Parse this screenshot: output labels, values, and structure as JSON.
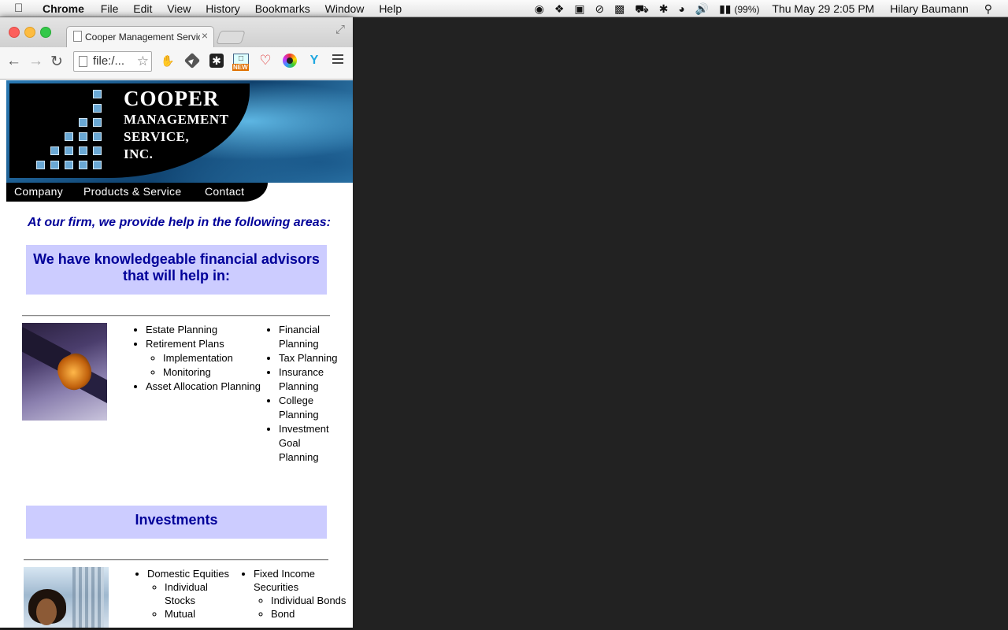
{
  "menubar": {
    "app": "Chrome",
    "menus": [
      "File",
      "Edit",
      "View",
      "History",
      "Bookmarks",
      "Window",
      "Help"
    ],
    "battery": "(99%)",
    "clock": "Thu May 29  2:05 PM",
    "user": "Hilary Baumann"
  },
  "browser": {
    "tab_title": "Cooper Management Services",
    "url": "file:/..."
  },
  "site": {
    "logo": {
      "line1": "COOPER",
      "line2": "MANAGEMENT",
      "line3": "SERVICE,",
      "line4": "INC."
    },
    "nav": {
      "company": "Company",
      "products": "Products & Service",
      "contact": "Contact"
    },
    "intro": "At our firm, we provide help in the following areas:",
    "advisors_heading": "We have knowledgeable financial advisors that will help in:",
    "services_left": {
      "estate": "Estate Planning",
      "retirement": "Retirement Plans",
      "implementation": "Implementation",
      "monitoring": "Monitoring",
      "asset": "Asset Allocation Planning"
    },
    "services_right": [
      "Financial Planning",
      "Tax Planning",
      "Insurance Planning",
      "College Planning",
      "Investment Goal Planning"
    ],
    "investments_heading": "Investments",
    "investments_left": {
      "domestic": "Domestic Equities",
      "individual_stocks": "Individual Stocks",
      "mutual": "Mutual"
    },
    "investments_right": {
      "fixed": "Fixed Income Securities",
      "individual_bonds": "Individual Bonds",
      "bond": "Bond"
    }
  },
  "colors": {
    "heading_blue": "#000099",
    "box_lavender": "#ccccff",
    "desktop": "#222222"
  }
}
